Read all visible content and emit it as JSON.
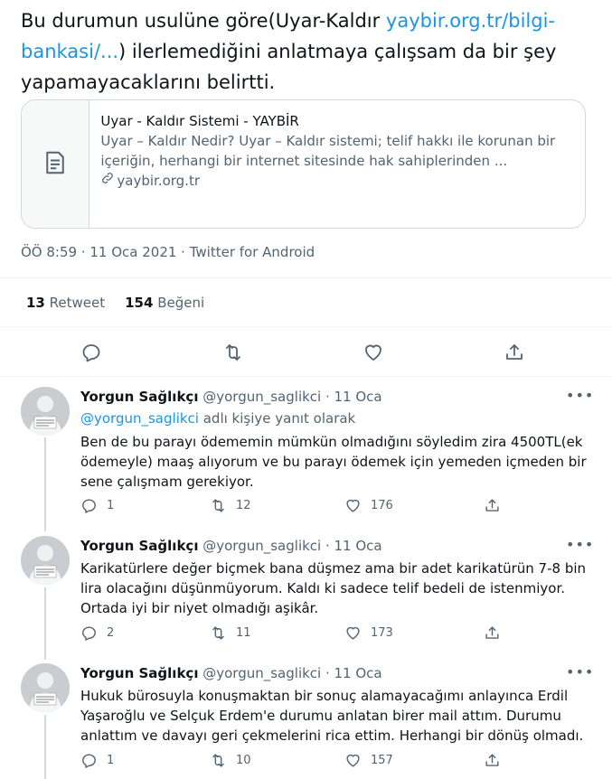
{
  "main_tweet": {
    "text_before": "Bu durumun usulüne göre(Uyar-Kaldır ",
    "link_text": "yaybir.org.tr/bilgi-bankasi/...",
    "text_after": ") ilerlemediğini anlatmaya çalışsam da bir şey yapamayacaklarını belirtti.",
    "card": {
      "title": "Uyar - Kaldır Sistemi - YAYBİR",
      "description": "Uyar – Kaldır Nedir? Uyar – Kaldır sistemi; telif hakkı ile korunan bir içeriğin, herhangi bir internet sitesinde hak sahiplerinden ...",
      "domain": "yaybir.org.tr",
      "thumb_icon": "document-icon"
    },
    "meta": "ÖÖ 8:59 · 11 Oca 2021 · Twitter for Android",
    "retweets_count": "13",
    "retweets_label": "Retweet",
    "likes_count": "154",
    "likes_label": "Beğeni",
    "icons": [
      "reply-icon",
      "retweet-icon",
      "like-icon",
      "share-icon"
    ]
  },
  "replies": [
    {
      "name": "Yorgun Sağlıkçı",
      "handle": "@yorgun_saglikci · 11 Oca",
      "reply_to_handle": "@yorgun_saglikci",
      "reply_to_suffix": " adlı kişiye yanıt olarak",
      "text": "Ben de bu parayı ödememin mümkün olmadığını söyledim zira 4500TL(ek ödemeyle) maaş alıyorum ve bu parayı ödemek için yemeden içmeden bir sene çalışmam gerekiyor.",
      "replies": "1",
      "retweets": "12",
      "likes": "176"
    },
    {
      "name": "Yorgun Sağlıkçı",
      "handle": "@yorgun_saglikci · 11 Oca",
      "text": "Karikatürlere değer biçmek bana düşmez ama bir adet karikatürün 7-8 bin lira olacağını düşünmüyorum. Kaldı ki sadece telif bedeli de istenmiyor. Ortada iyi bir niyet olmadığı aşikâr.",
      "replies": "2",
      "retweets": "11",
      "likes": "173"
    },
    {
      "name": "Yorgun Sağlıkçı",
      "handle": "@yorgun_saglikci · 11 Oca",
      "text": "Hukuk bürosuyla konuşmaktan bir sonuç alamayacağımı anlayınca Erdil Yaşaroğlu ve Selçuk Erdem'e durumu anlatan birer mail attım. Durumu anlattım ve davayı geri çekmelerini rica ettim. Herhangi bir dönüş olmadı.",
      "replies": "1",
      "retweets": "10",
      "likes": "157"
    }
  ],
  "colors": {
    "link": "#1b95e0",
    "text": "#0f1419",
    "secondary": "#536471",
    "border": "#cfd9de"
  }
}
